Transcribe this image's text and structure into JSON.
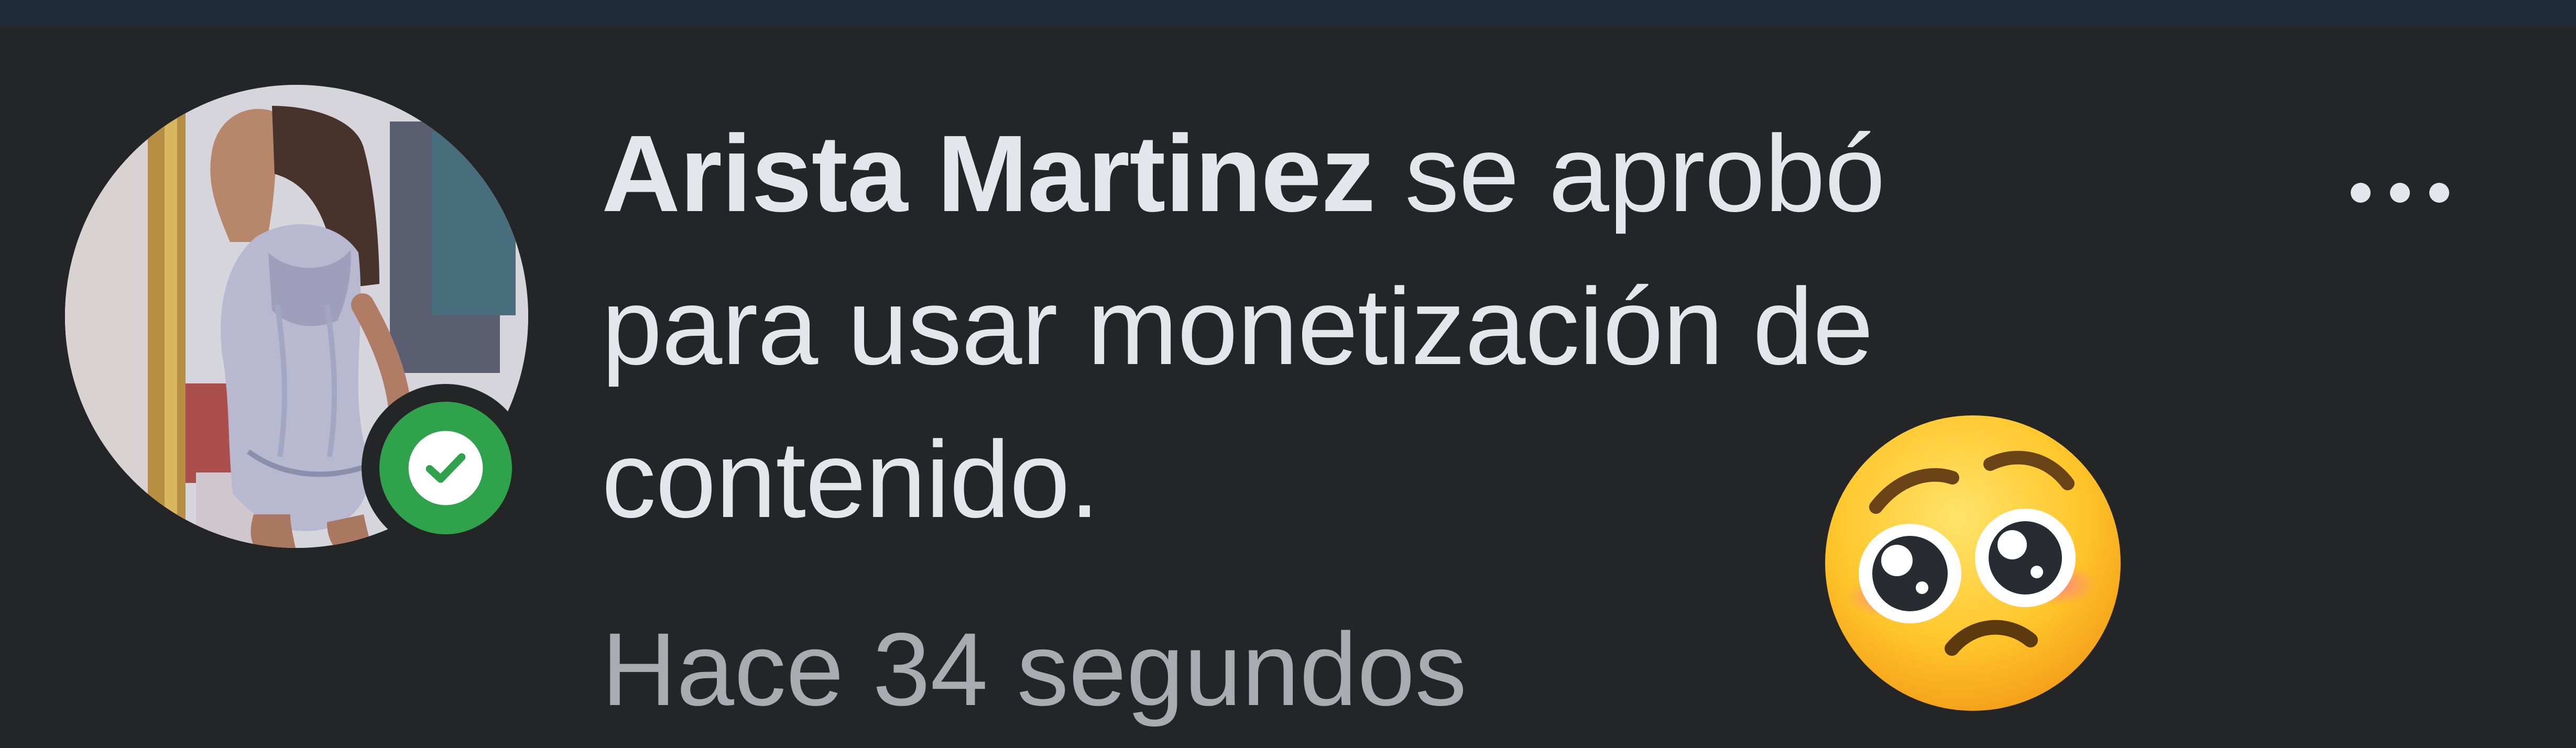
{
  "notification": {
    "actor_name": "Arista Martinez",
    "message": " se aprobó para usar monetización de contenido.",
    "timestamp": "Hace 34 segundos",
    "read": false
  },
  "icons": {
    "verified_badge": "check-circle-icon",
    "more_options": "ellipsis-icon",
    "reaction": "pleading-face-emoji"
  },
  "colors": {
    "background": "#242526",
    "top_bar": "#1f2b38",
    "primary_text": "#e4e6eb",
    "secondary_text": "#a8abaf",
    "verified_green": "#31a24c",
    "emoji_yellow": "#ffc62b"
  }
}
